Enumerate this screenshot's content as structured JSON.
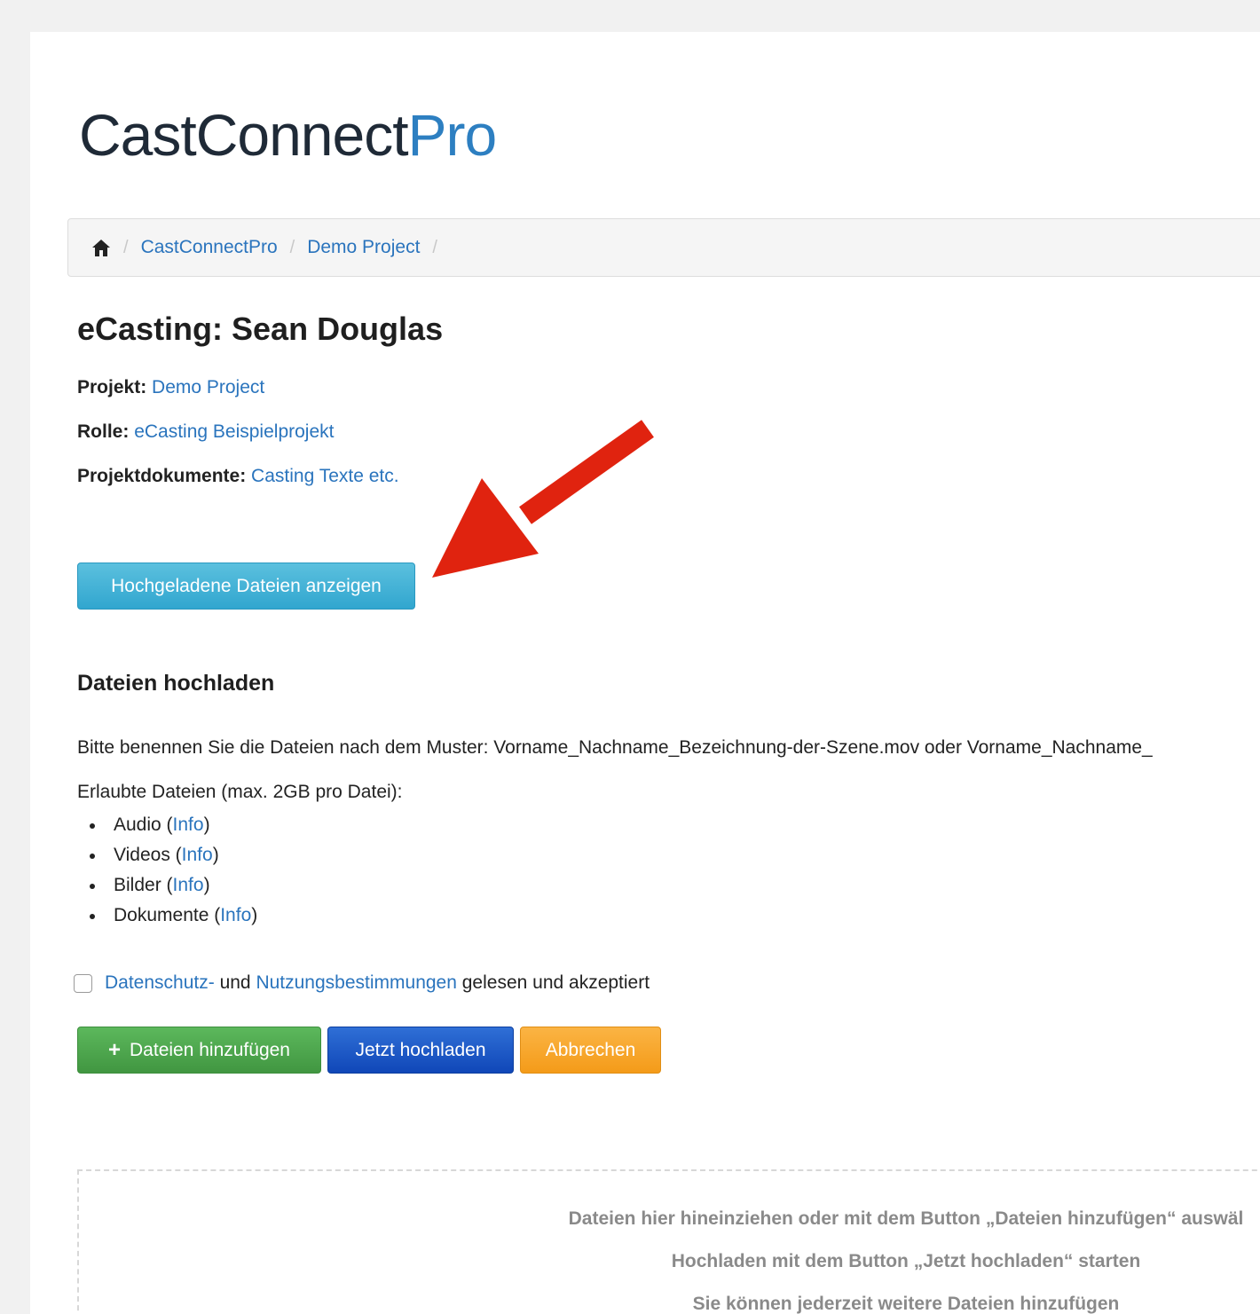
{
  "logo": {
    "part1": "CastConnect",
    "part2": "Pro"
  },
  "breadcrumb": {
    "home_icon": "home-icon",
    "items": [
      "CastConnectPro",
      "Demo Project"
    ],
    "separator": "/"
  },
  "page": {
    "title": "eCasting: Sean Douglas"
  },
  "meta": {
    "projekt_label": "Projekt:",
    "projekt_value": "Demo Project",
    "rolle_label": "Rolle:",
    "rolle_value": "eCasting Beispielprojekt",
    "dokumente_label": "Projektdokumente:",
    "dokumente_value": "Casting Texte etc."
  },
  "buttons": {
    "show_uploaded": "Hochgeladene Dateien anzeigen",
    "add_files": "Dateien hinzufügen",
    "upload_now": "Jetzt hochladen",
    "cancel": "Abbrechen"
  },
  "upload": {
    "heading": "Dateien hochladen",
    "naming_hint": "Bitte benennen Sie die Dateien nach dem Muster: Vorname_Nachname_Bezeichnung-der-Szene.mov oder Vorname_Nachname_",
    "allowed_label": "Erlaubte Dateien (max. 2GB pro Datei):",
    "types": [
      {
        "name": "Audio",
        "info": "Info"
      },
      {
        "name": "Videos",
        "info": "Info"
      },
      {
        "name": "Bilder",
        "info": "Info"
      },
      {
        "name": "Dokumente",
        "info": "Info"
      }
    ],
    "consent": {
      "link1": "Datenschutz-",
      "and": " und ",
      "link2": "Nutzungsbestimmungen",
      "rest": " gelesen und akzeptiert"
    }
  },
  "dropzone": {
    "line1": "Dateien hier hineinziehen oder mit dem Button „Dateien hinzufügen“ auswäl",
    "line2": "Hochladen mit dem Button „Jetzt hochladen“ starten",
    "line3": "Sie können jederzeit weitere Dateien hinzufügen"
  },
  "colors": {
    "link": "#2a74bd",
    "arrow": "#e0230f",
    "info_button": "#31a6cf",
    "success_button": "#419641",
    "primary_button": "#1047b8",
    "warning_button": "#f49b19"
  }
}
